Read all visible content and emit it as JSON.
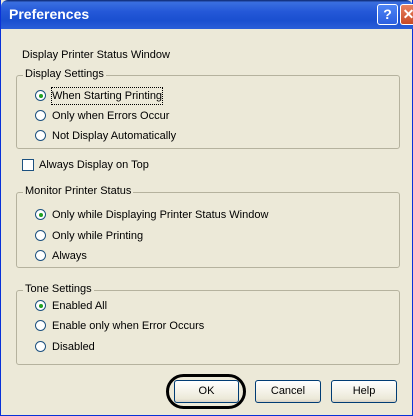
{
  "window": {
    "title": "Preferences",
    "help_glyph": "?",
    "close_glyph": "✕"
  },
  "header_text": "Display Printer Status Window",
  "display_settings": {
    "legend": "Display Settings",
    "options": [
      {
        "label": "When Starting Printing",
        "selected": true
      },
      {
        "label": "Only when Errors Occur",
        "selected": false
      },
      {
        "label": "Not Display Automatically",
        "selected": false
      }
    ]
  },
  "always_on_top": {
    "label": "Always Display on Top",
    "checked": false
  },
  "monitor_status": {
    "legend": "Monitor Printer Status",
    "options": [
      {
        "label": "Only while Displaying Printer Status Window",
        "selected": true
      },
      {
        "label": "Only while Printing",
        "selected": false
      },
      {
        "label": "Always",
        "selected": false
      }
    ]
  },
  "tone_settings": {
    "legend": "Tone Settings",
    "options": [
      {
        "label": "Enabled All",
        "selected": true
      },
      {
        "label": "Enable only when Error Occurs",
        "selected": false
      },
      {
        "label": "Disabled",
        "selected": false
      }
    ]
  },
  "buttons": {
    "ok": "OK",
    "cancel": "Cancel",
    "help": "Help"
  }
}
